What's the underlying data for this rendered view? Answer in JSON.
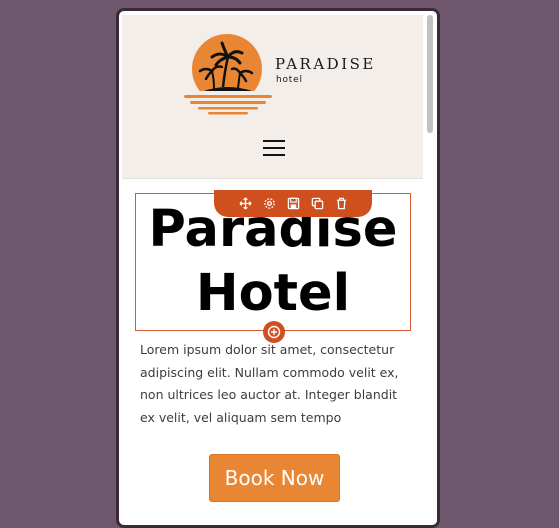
{
  "header": {
    "brand_name": "PARADISE",
    "brand_sub": "hotel"
  },
  "hero": {
    "title_line1": "Paradise",
    "title_line2": "Hotel"
  },
  "content": {
    "paragraph": "Lorem ipsum dolor sit amet, consectetur adipiscing elit. Nullam commodo velit ex, non ultrices leo auctor at. Integer blandit ex velit, vel aliquam sem tempo"
  },
  "cta": {
    "label": "Book Now"
  },
  "toolbar": {
    "icons": [
      "move-icon",
      "gear-icon",
      "save-icon",
      "duplicate-icon",
      "trash-icon"
    ]
  },
  "colors": {
    "accent": "#cf4f1e",
    "button": "#e98634",
    "header_bg": "#f3eeea",
    "page_bg": "#6e566d"
  }
}
